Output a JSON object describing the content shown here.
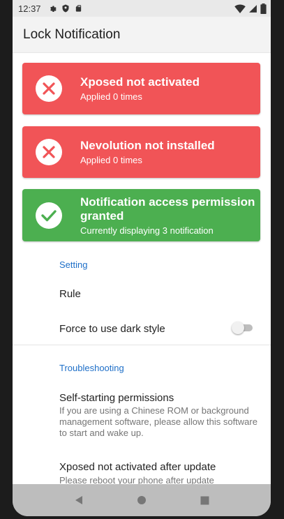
{
  "status_bar": {
    "time": "12:37",
    "icons": [
      "gear-icon",
      "shield-icon",
      "sd-card-icon"
    ],
    "right_icons": [
      "wifi-icon",
      "signal-icon",
      "battery-icon"
    ]
  },
  "app_bar": {
    "title": "Lock Notification"
  },
  "cards": [
    {
      "status": "error",
      "icon": "x-icon",
      "color": "#f15457",
      "title": "Xposed not activated",
      "subtitle": "Applied 0 times"
    },
    {
      "status": "error",
      "icon": "x-icon",
      "color": "#f15457",
      "title": "Nevolution not installed",
      "subtitle": "Applied 0 times"
    },
    {
      "status": "ok",
      "icon": "check-icon",
      "color": "#4caf50",
      "title": "Notification access permission granted",
      "subtitle": "Currently displaying 3 notification"
    }
  ],
  "setting": {
    "header": "Setting",
    "rule": "Rule",
    "dark_style": {
      "label": "Force to use dark style",
      "enabled": false
    }
  },
  "troubleshooting": {
    "header": "Troubleshooting",
    "items": [
      {
        "title": "Self-starting permissions",
        "summary": "If you are using a Chinese ROM or background management software, please allow this software to start and wake up."
      },
      {
        "title": "Xposed not activated after update",
        "summary": "Please reboot your phone after update"
      }
    ]
  },
  "colors": {
    "accent": "#1e6fc8",
    "error": "#f15457",
    "success": "#4caf50"
  },
  "nav_bar": {
    "buttons": [
      "back-icon",
      "home-icon",
      "recents-icon"
    ]
  }
}
